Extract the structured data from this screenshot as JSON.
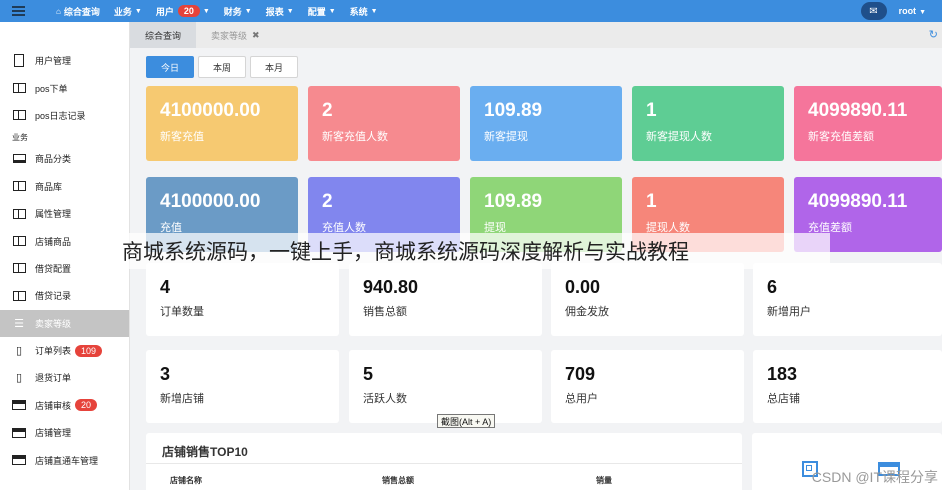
{
  "topbar": {
    "nav": [
      {
        "label": "综合查询",
        "icon": "home-icon"
      },
      {
        "label": "业务",
        "caret": true
      },
      {
        "label": "用户",
        "badge": "20",
        "caret": true
      },
      {
        "label": "财务",
        "caret": true
      },
      {
        "label": "报表",
        "caret": true
      },
      {
        "label": "配置",
        "caret": true
      },
      {
        "label": "系统",
        "caret": true
      }
    ],
    "user": "root"
  },
  "tabs": [
    {
      "label": "综合查询",
      "active": true
    },
    {
      "label": "卖家等级",
      "closable": true
    }
  ],
  "sidebar": {
    "items": [
      {
        "label": "用户管理",
        "icon": "doc-icon"
      },
      {
        "label": "pos下单",
        "icon": "book-icon"
      },
      {
        "label": "pos日志记录",
        "icon": "book-icon"
      },
      {
        "group": "业务"
      },
      {
        "label": "商品分类",
        "icon": "laptop-icon"
      },
      {
        "label": "商品库",
        "icon": "book-icon"
      },
      {
        "label": "属性管理",
        "icon": "book-icon"
      },
      {
        "label": "店铺商品",
        "icon": "book-icon"
      },
      {
        "label": "借贷配置",
        "icon": "book-icon"
      },
      {
        "label": "借贷记录",
        "icon": "book-icon"
      },
      {
        "label": "卖家等级",
        "icon": "list-icon",
        "active": true
      },
      {
        "label": "订单列表",
        "icon": "phone-icon",
        "badge": "109"
      },
      {
        "label": "退货订单",
        "icon": "phone-icon"
      },
      {
        "label": "店铺审核",
        "icon": "card-icon",
        "badge": "20"
      },
      {
        "label": "店铺管理",
        "icon": "card-icon"
      },
      {
        "label": "店铺直通车管理",
        "icon": "card-icon"
      }
    ]
  },
  "filters": [
    "今日",
    "本周",
    "本月"
  ],
  "stats_row1": [
    {
      "value": "4100000.00",
      "label": "新客充值",
      "color": "#f6c971"
    },
    {
      "value": "2",
      "label": "新客充值人数",
      "color": "#f68a8f"
    },
    {
      "value": "109.89",
      "label": "新客提现",
      "color": "#6aaef0"
    },
    {
      "value": "1",
      "label": "新客提现人数",
      "color": "#5ecd94"
    },
    {
      "value": "4099890.11",
      "label": "新客充值差额",
      "color": "#f5759b"
    }
  ],
  "stats_row2": [
    {
      "value": "4100000.00",
      "label": "充值",
      "color": "#6b9bc6"
    },
    {
      "value": "2",
      "label": "充值人数",
      "color": "#8186ee"
    },
    {
      "value": "109.89",
      "label": "提现",
      "color": "#8fd678"
    },
    {
      "value": "1",
      "label": "提现人数",
      "color": "#f6867a"
    },
    {
      "value": "4099890.11",
      "label": "充值差额",
      "color": "#b065e9"
    }
  ],
  "summary_row1": [
    {
      "value": "4",
      "label": "订单数量"
    },
    {
      "value": "940.80",
      "label": "销售总额"
    },
    {
      "value": "0.00",
      "label": "佣金发放"
    },
    {
      "value": "6",
      "label": "新增用户"
    }
  ],
  "summary_row2": [
    {
      "value": "3",
      "label": "新增店铺"
    },
    {
      "value": "5",
      "label": "活跃人数"
    },
    {
      "value": "709",
      "label": "总用户"
    },
    {
      "value": "183",
      "label": "总店铺"
    }
  ],
  "top_table": {
    "title": "店铺销售TOP10",
    "columns": [
      "店铺名称",
      "销售总额",
      "销量"
    ]
  },
  "overlay_text": "商城系统源码，一键上手，商城系统源码深度解析与实战教程",
  "tooltip": "截图(Alt + A)",
  "watermark": "CSDN @IT课程分享"
}
